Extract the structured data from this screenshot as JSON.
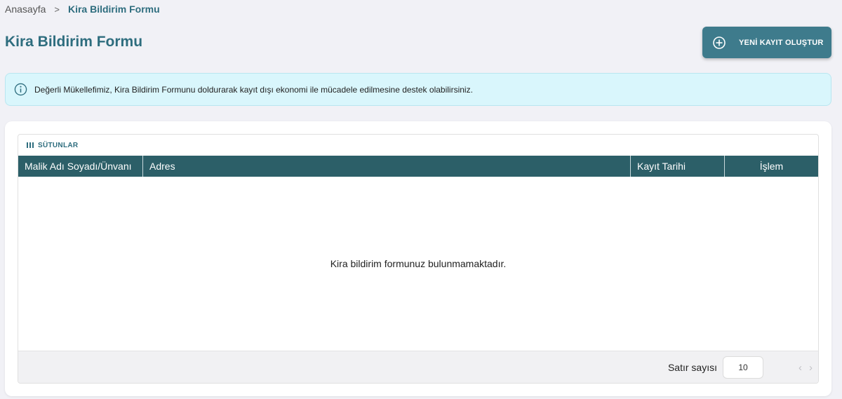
{
  "breadcrumb": {
    "home": "Anasayfa",
    "separator": ">",
    "current": "Kira Bildirim Formu"
  },
  "page": {
    "title": "Kira Bildirim Formu"
  },
  "actions": {
    "new_record_label": "YENİ KAYIT OLUŞTUR",
    "new_record_icon": "plus-circle-icon"
  },
  "info": {
    "icon": "info-circle-icon",
    "text": "Değerli Mükellefimiz, Kira Bildirim Formunu doldurarak kayıt dışı ekonomi ile mücadele edilmesine destek olabilirsiniz."
  },
  "grid": {
    "toolbar": {
      "columns_label": "SÜTUNLAR",
      "columns_icon": "columns-icon"
    },
    "columns": [
      "Malik Adı Soyadı/Ünvanı",
      "Adres",
      "Kayıt Tarihi",
      "İşlem"
    ],
    "empty_message": "Kira bildirim formunuz bulunmamaktadır.",
    "footer": {
      "rows_label": "Satır sayısı",
      "rows_value": "10",
      "prev_icon": "chevron-left-icon",
      "next_icon": "chevron-right-icon"
    }
  },
  "colors": {
    "accent": "#2e6d7e",
    "button": "#3e7b8c",
    "header": "#2c5f68",
    "info_bg": "#d9f6fc",
    "background": "#f1f1f6"
  }
}
